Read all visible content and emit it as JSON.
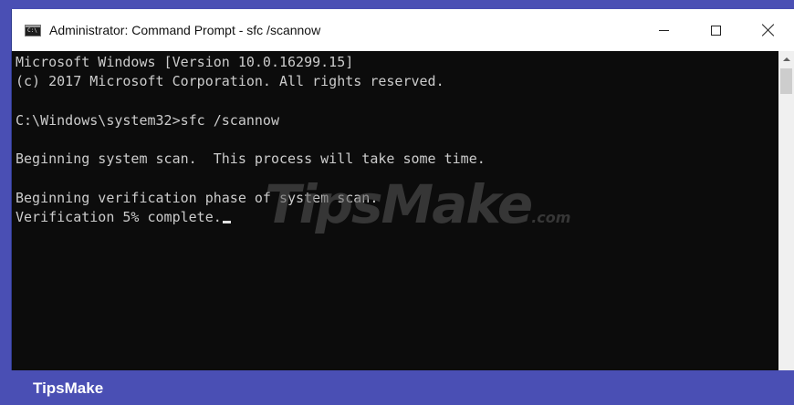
{
  "window": {
    "title": "Administrator: Command Prompt - sfc  /scannow",
    "app_icon": "cmd-icon",
    "app_icon_text": "C:\\",
    "controls": {
      "minimize_icon": "minimize-icon",
      "maximize_icon": "maximize-icon",
      "close_icon": "close-icon"
    }
  },
  "console": {
    "background": "#0c0c0c",
    "text_color": "#cccccc",
    "lines": [
      "Microsoft Windows [Version 10.0.16299.15]",
      "(c) 2017 Microsoft Corporation. All rights reserved.",
      "",
      "C:\\Windows\\system32>sfc /scannow",
      "",
      "Beginning system scan.  This process will take some time.",
      "",
      "Beginning verification phase of system scan.",
      "Verification 5% complete."
    ]
  },
  "watermark": {
    "text": "TipsMake",
    "suffix": ".com"
  },
  "footer": {
    "label": "TipsMake",
    "background": "#4a4fb4"
  }
}
